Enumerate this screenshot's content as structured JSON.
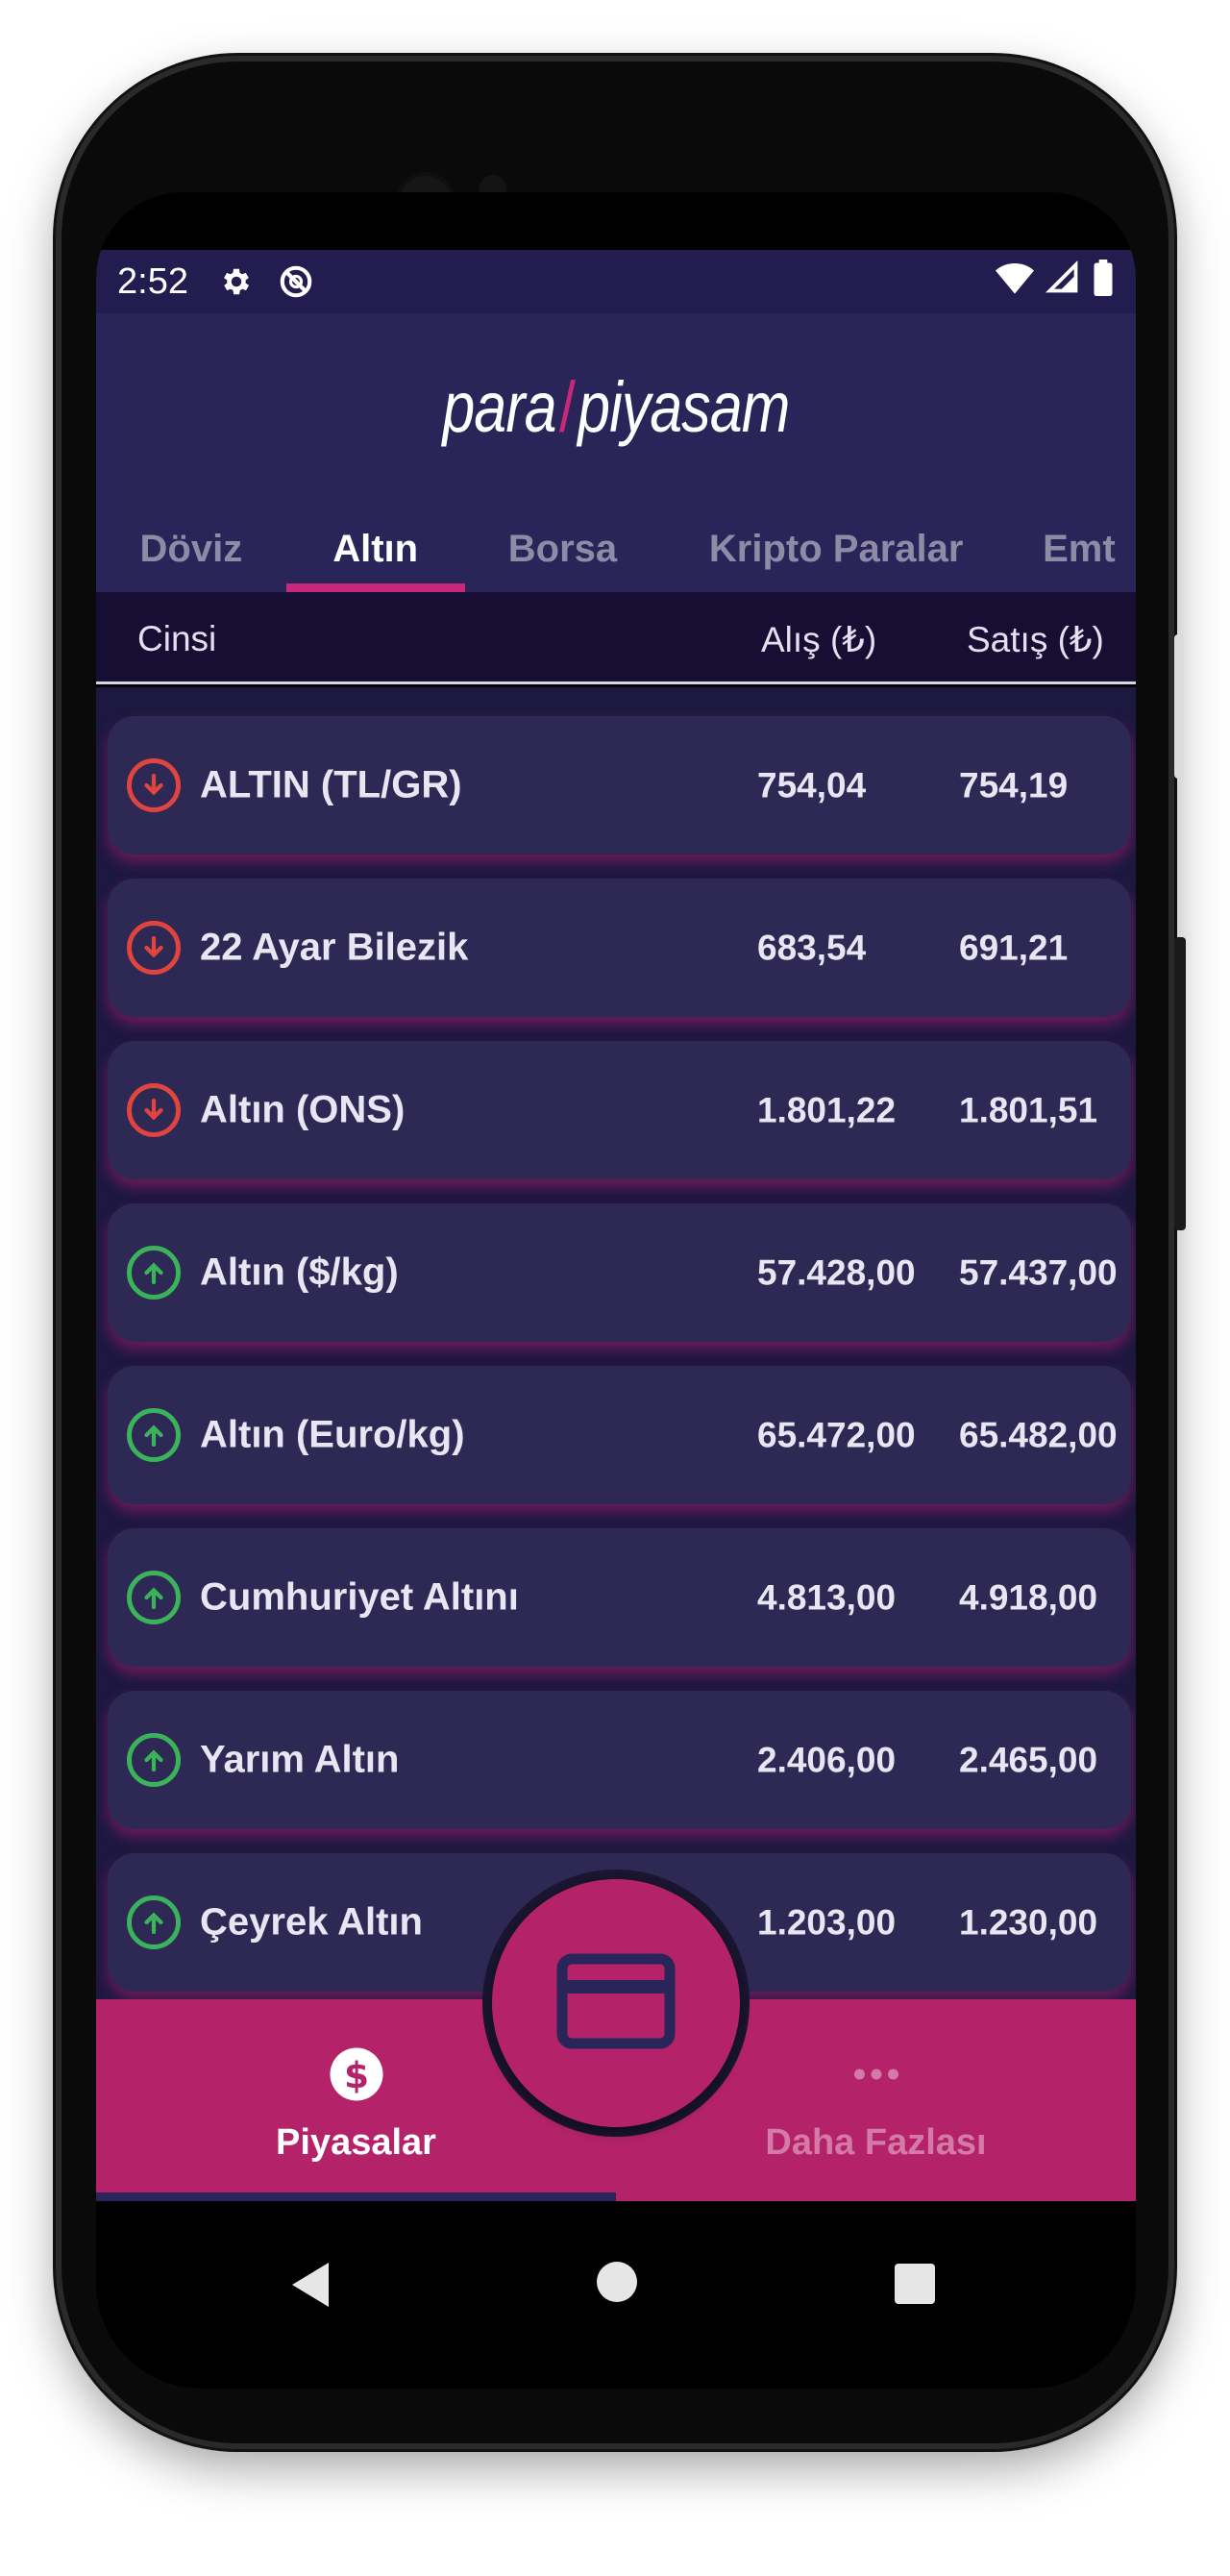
{
  "status_bar": {
    "time": "2:52",
    "icons": [
      "gear-icon",
      "sync-off-icon",
      "wifi-icon",
      "signal-icon",
      "battery-icon"
    ]
  },
  "header": {
    "logo_left": "para",
    "logo_right": "piyasam",
    "tabs": [
      {
        "label": "Döviz",
        "active": false
      },
      {
        "label": "Altın",
        "active": true
      },
      {
        "label": "Borsa",
        "active": false
      },
      {
        "label": "Kripto Paralar",
        "active": false
      },
      {
        "label": "Emt",
        "active": false
      }
    ]
  },
  "table": {
    "col_name": "Cinsi",
    "col_buy": "Alış (₺)",
    "col_sell": "Satış (₺)",
    "rows": [
      {
        "name": "ALTIN (TL/GR)",
        "buy": "754,04",
        "sell": "754,19",
        "trend": "down"
      },
      {
        "name": "22 Ayar Bilezik",
        "buy": "683,54",
        "sell": "691,21",
        "trend": "down"
      },
      {
        "name": "Altın (ONS)",
        "buy": "1.801,22",
        "sell": "1.801,51",
        "trend": "down"
      },
      {
        "name": "Altın ($/kg)",
        "buy": "57.428,00",
        "sell": "57.437,00",
        "trend": "up"
      },
      {
        "name": "Altın (Euro/kg)",
        "buy": "65.472,00",
        "sell": "65.482,00",
        "trend": "up"
      },
      {
        "name": "Cumhuriyet Altını",
        "buy": "4.813,00",
        "sell": "4.918,00",
        "trend": "up"
      },
      {
        "name": "Yarım Altın",
        "buy": "2.406,00",
        "sell": "2.465,00",
        "trend": "up"
      },
      {
        "name": "Çeyrek Altın",
        "buy": "1.203,00",
        "sell": "1.230,00",
        "trend": "up"
      }
    ]
  },
  "bottom_nav": {
    "items": [
      {
        "label": "Piyasalar",
        "icon": "dollar-icon",
        "active": true
      },
      {
        "label": "Daha Fazlası",
        "icon": "more-icon",
        "active": false
      }
    ],
    "fab_icon": "card-icon"
  },
  "colors": {
    "accent": "#b42369",
    "header_bg": "#2a2559",
    "row_bg": "#2d2854",
    "trend_down": "#e0443e",
    "trend_up": "#3bb35a"
  }
}
